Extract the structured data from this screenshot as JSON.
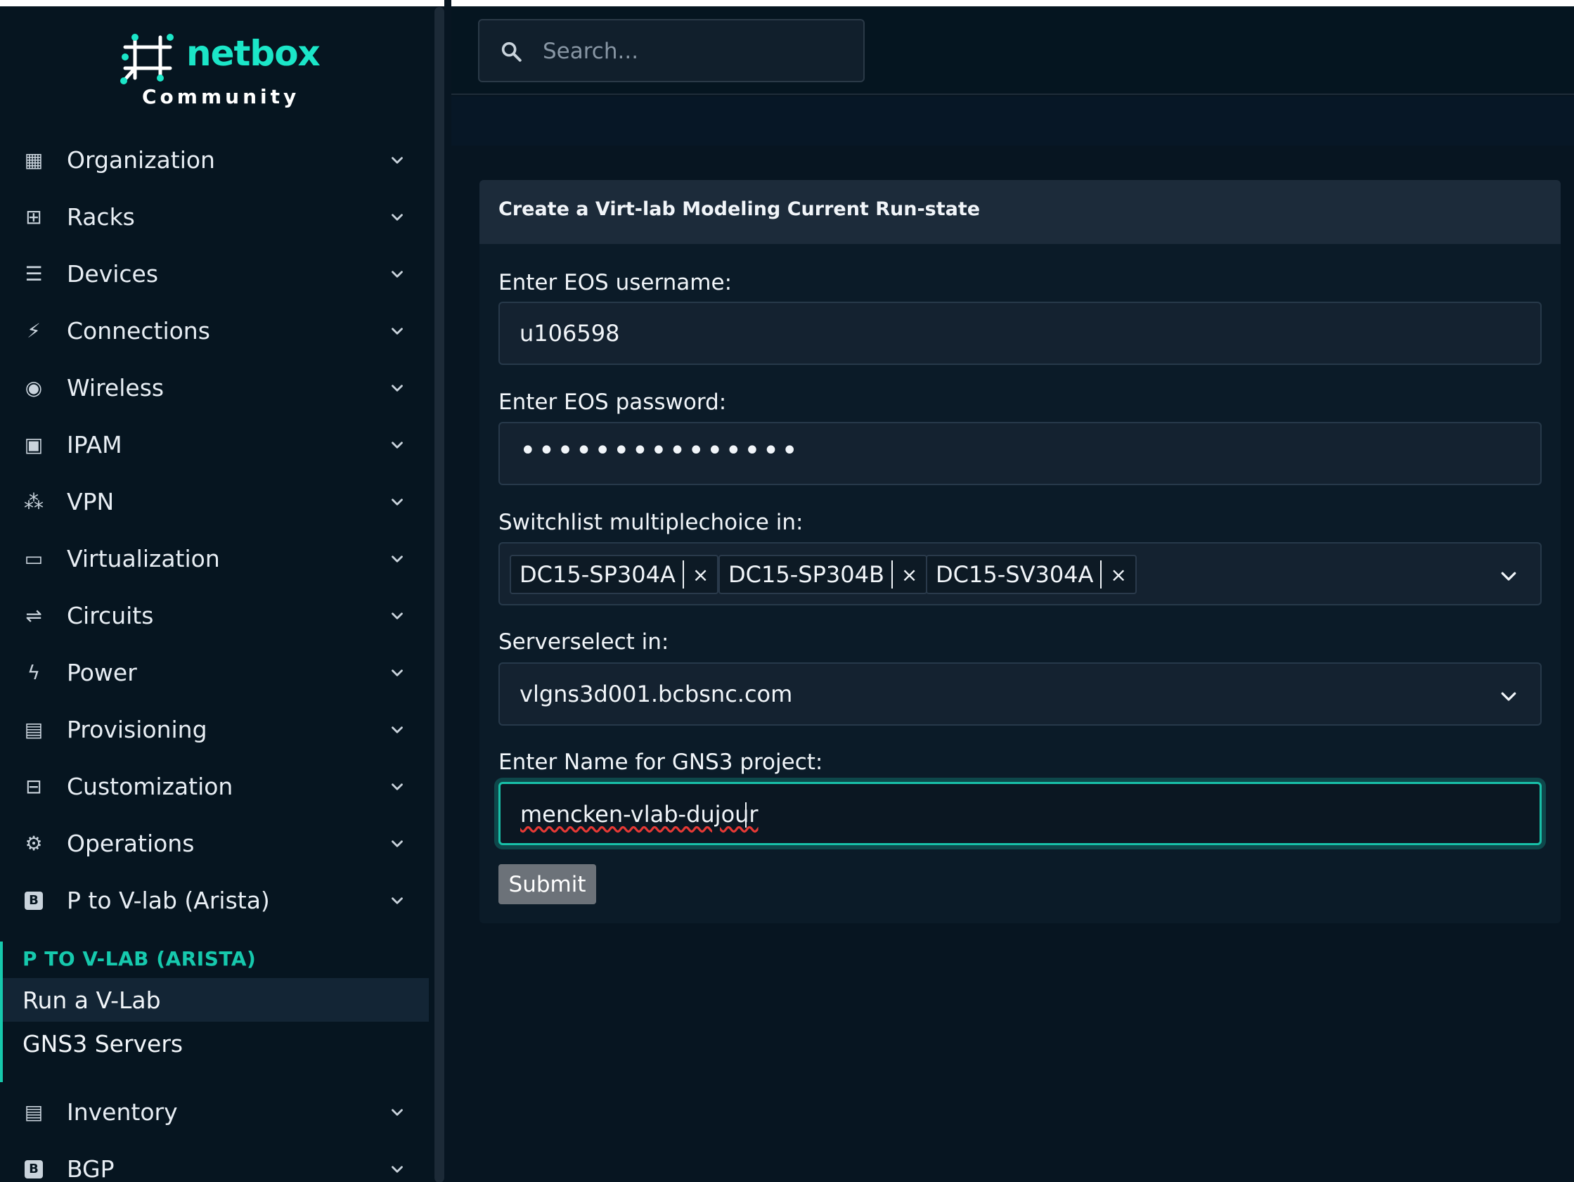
{
  "brand": {
    "name": "netbox",
    "tagline": "Community"
  },
  "search": {
    "placeholder": "Search..."
  },
  "sidebar": {
    "items": [
      {
        "label": "Organization",
        "icon": "building-icon",
        "glyph": "▦"
      },
      {
        "label": "Racks",
        "icon": "rack-icon",
        "glyph": "⊞"
      },
      {
        "label": "Devices",
        "icon": "server-icon",
        "glyph": "☰"
      },
      {
        "label": "Connections",
        "icon": "plug-icon",
        "glyph": "⚡"
      },
      {
        "label": "Wireless",
        "icon": "wifi-icon",
        "glyph": "◉"
      },
      {
        "label": "IPAM",
        "icon": "ip-icon",
        "glyph": "▣"
      },
      {
        "label": "VPN",
        "icon": "vpn-icon",
        "glyph": "⁂"
      },
      {
        "label": "Virtualization",
        "icon": "monitor-icon",
        "glyph": "▭"
      },
      {
        "label": "Circuits",
        "icon": "circuit-icon",
        "glyph": "⇌"
      },
      {
        "label": "Power",
        "icon": "power-icon",
        "glyph": "ϟ"
      },
      {
        "label": "Provisioning",
        "icon": "file-icon",
        "glyph": "▤"
      },
      {
        "label": "Customization",
        "icon": "toolbox-icon",
        "glyph": "⊟"
      },
      {
        "label": "Operations",
        "icon": "cogs-icon",
        "glyph": "⚙"
      },
      {
        "label": "P to V-lab (Arista)",
        "icon": "plugin-b-icon",
        "glyph": "B"
      }
    ],
    "section": {
      "header": "P TO V-LAB (ARISTA)",
      "links": [
        "Run a V-Lab",
        "GNS3 Servers"
      ]
    },
    "items_after": [
      {
        "label": "Inventory",
        "icon": "clipboard-icon",
        "glyph": "▤"
      },
      {
        "label": "BGP",
        "icon": "plugin-b-icon",
        "glyph": "B"
      }
    ]
  },
  "form": {
    "title": "Create a Virt-lab Modeling Current Run-state",
    "username_label": "Enter EOS username:",
    "username_value": "u106598",
    "password_label": "Enter EOS password:",
    "password_value": "•••••••••••••••",
    "switchlist_label": "Switchlist multiplechoice in:",
    "switches": [
      "DC15-SP304A",
      "DC15-SP304B",
      "DC15-SV304A"
    ],
    "chip_remove": "×",
    "server_label": "Serverselect in:",
    "server_value": "vlgns3d001.bcbsnc.com",
    "project_label": "Enter Name for GNS3 project:",
    "project_value": "mencken-vlab-dujour",
    "submit_label": "Submit"
  },
  "colors": {
    "accent": "#16c9ad",
    "background": "#071521",
    "card": "#0b1b28"
  }
}
